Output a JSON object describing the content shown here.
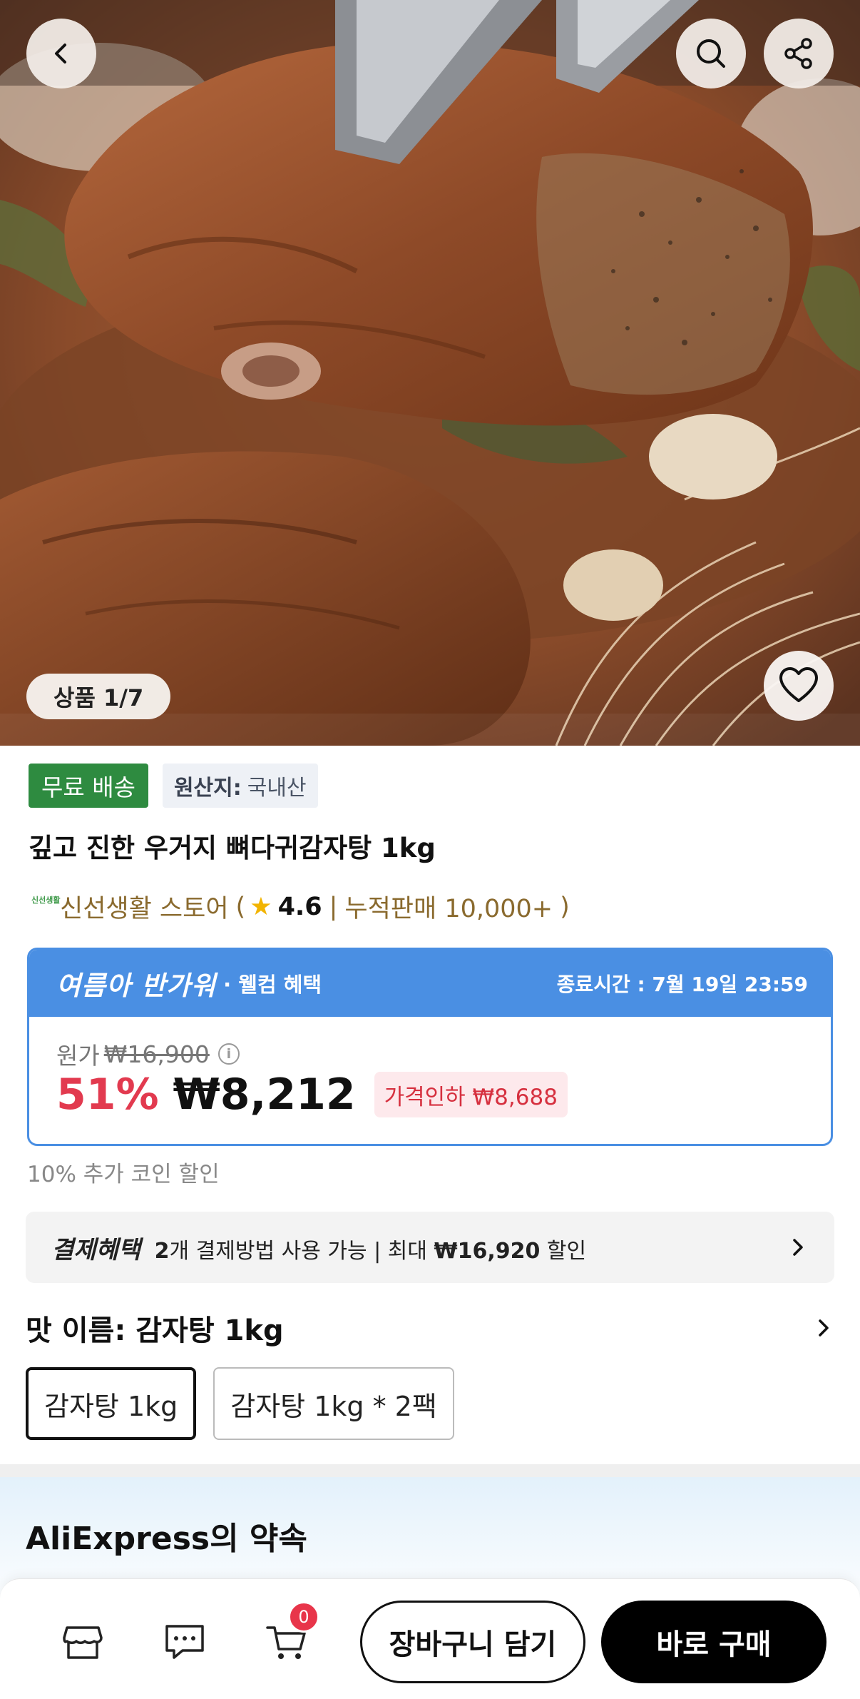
{
  "hero": {
    "image_counter": "상품 1/7",
    "back_icon": "chevron-left-icon",
    "search_icon": "search-icon",
    "share_icon": "share-icon",
    "favorite_icon": "heart-icon"
  },
  "product": {
    "tags": {
      "free_shipping": "무료 배송",
      "origin_label": "원산지:",
      "origin_value": "국내산"
    },
    "title": "깊고 진한 우거지 뼈다귀감자탕 1kg",
    "store": {
      "logo_text": "신선생활",
      "name": "신선생활 스토어",
      "paren_open": "(",
      "rating": "4.6",
      "separator": "|",
      "sales": "누적판매 10,000+",
      "paren_close": ")"
    }
  },
  "price_card": {
    "promo_title": "여름아 반가워",
    "promo_sub": "· 웰컴 혜택",
    "end_time": "종료시간 : 7월 19일 23:59",
    "original_label": "원가",
    "original_price": "₩16,900",
    "discount": "51%",
    "sale_price": "₩8,212",
    "price_drop": "가격인하 ₩8,688"
  },
  "coin_discount": "10% 추가 코인 할인",
  "payment": {
    "title": "결제혜택",
    "count": "2",
    "text1": "개 결제방법 사용 가능 | 최대",
    "max_amount": "₩16,920",
    "text2": "할인"
  },
  "flavor": {
    "label": "맛 이름: 감자탕 1kg",
    "options": [
      "감자탕 1kg",
      "감자탕 1kg * 2팩"
    ],
    "selected": 0
  },
  "promise": {
    "title": "AliExpress의 약속"
  },
  "bottom_bar": {
    "cart_count": "0",
    "add_to_cart": "장바구니 담기",
    "buy_now": "바로 구매"
  },
  "colors": {
    "accent_red": "#e23a4f",
    "promo_blue": "#4a8fe3",
    "free_ship_green": "#2e8b40",
    "store_gold": "#8a6a2e"
  }
}
